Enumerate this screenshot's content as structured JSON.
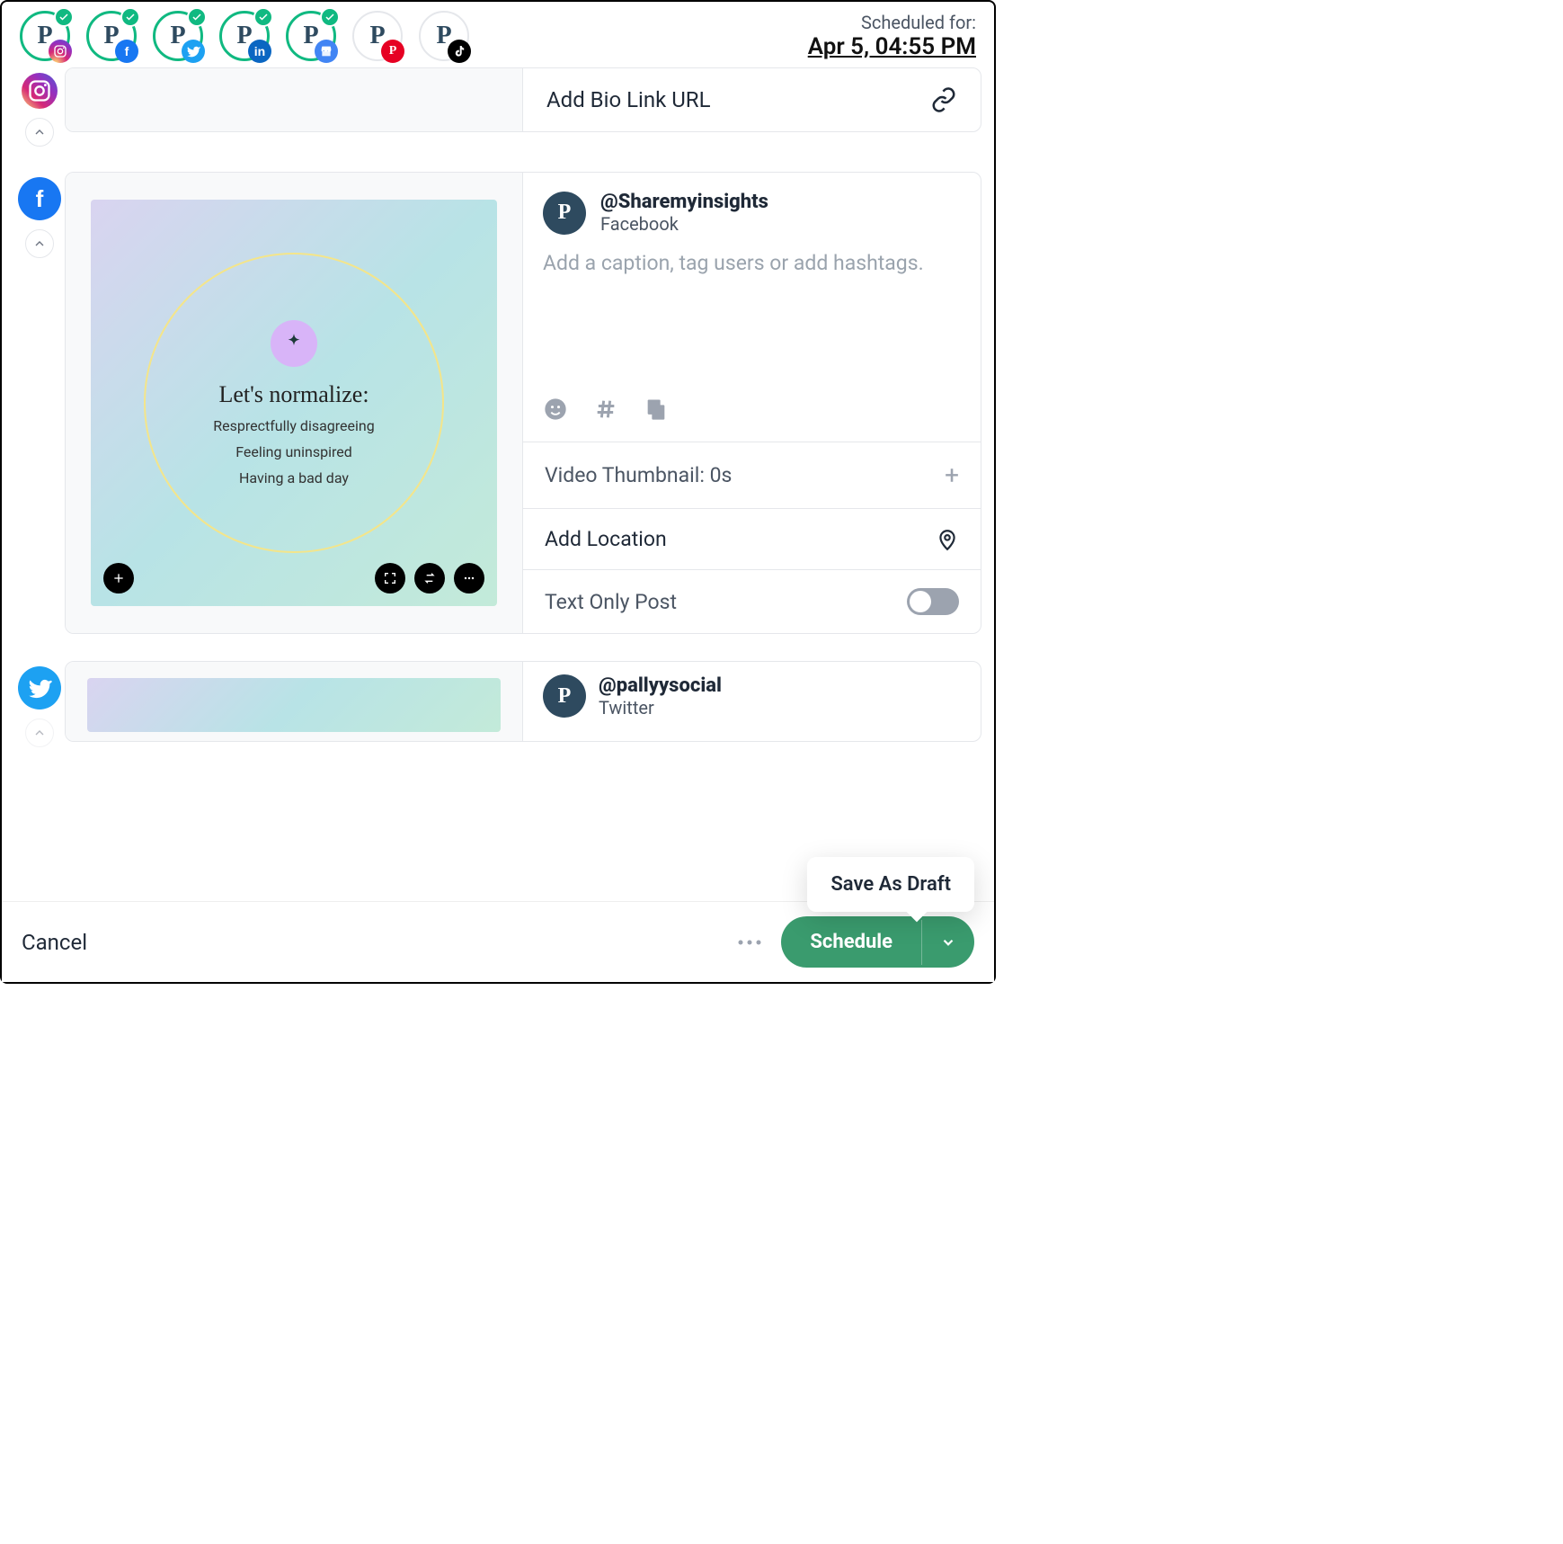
{
  "header": {
    "scheduled_label": "Scheduled for:",
    "scheduled_time": "Apr 5, 04:55 PM",
    "accounts": [
      {
        "network": "instagram",
        "selected": true
      },
      {
        "network": "facebook",
        "selected": true
      },
      {
        "network": "twitter",
        "selected": true
      },
      {
        "network": "linkedin",
        "selected": true
      },
      {
        "network": "google",
        "selected": true
      },
      {
        "network": "pinterest",
        "selected": false
      },
      {
        "network": "tiktok",
        "selected": false
      }
    ]
  },
  "instagram_partial": {
    "bio_link_label": "Add Bio Link URL"
  },
  "media": {
    "title": "Let's normalize:",
    "lines": [
      "Resprectfully disagreeing",
      "Feeling uninspired",
      "Having a bad day"
    ]
  },
  "facebook": {
    "handle": "@Sharemyinsights",
    "network_label": "Facebook",
    "caption_placeholder": "Add a caption, tag users or add hashtags.",
    "video_thumb_label": "Video Thumbnail: 0s",
    "location_label": "Add Location",
    "text_only_label": "Text Only Post"
  },
  "twitter": {
    "handle": "@pallyysocial",
    "network_label": "Twitter"
  },
  "footer": {
    "cancel": "Cancel",
    "schedule": "Schedule",
    "save_draft": "Save As Draft"
  }
}
